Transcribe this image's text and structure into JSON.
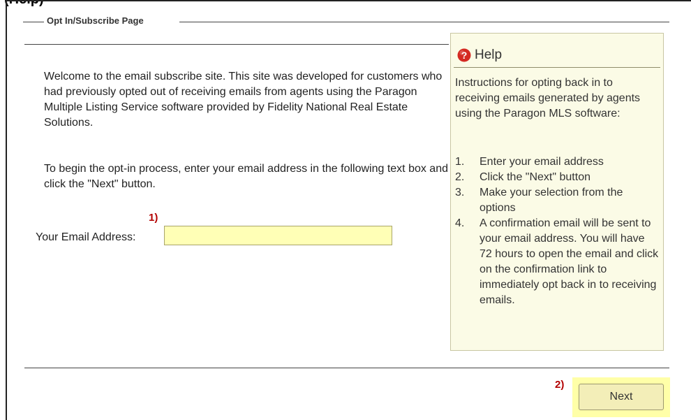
{
  "page_title_partial": "(Help)",
  "fieldset": {
    "legend": "Opt In/Subscribe Page"
  },
  "intro": {
    "paragraph1": "Welcome to the email subscribe site. This site was developed for customers who had previously opted out of receiving emails from agents using the Paragon Multiple Listing Service software provided by Fidelity National Real Estate Solutions.",
    "paragraph2": "To begin the opt-in process, enter your email address in the following text box and click the \"Next\" button."
  },
  "form": {
    "step1_marker": "1)",
    "email_label": "Your Email Address:",
    "email_value": "",
    "step2_marker": "2)",
    "next_label": "Next"
  },
  "help": {
    "icon": "question-circle-icon",
    "title": "Help",
    "intro": "Instructions for opting back in to receiving emails generated by agents using the Paragon MLS software:",
    "steps": [
      {
        "num": "1.",
        "text": "Enter your email address"
      },
      {
        "num": "2.",
        "text": "Click the \"Next\" button"
      },
      {
        "num": "3.",
        "text": "Make your selection from the options"
      },
      {
        "num": "4.",
        "text": "A confirmation email will be sent to your email address. You will have 72 hours to open the email and click on the confirmation link to immediately opt back in to receiving emails."
      }
    ]
  },
  "colors": {
    "input_background": "#ffffb6",
    "help_background": "#fbfbe6",
    "step_marker": "#b30000",
    "help_icon": "#d42a22",
    "next_highlight": "#ffffa8"
  }
}
